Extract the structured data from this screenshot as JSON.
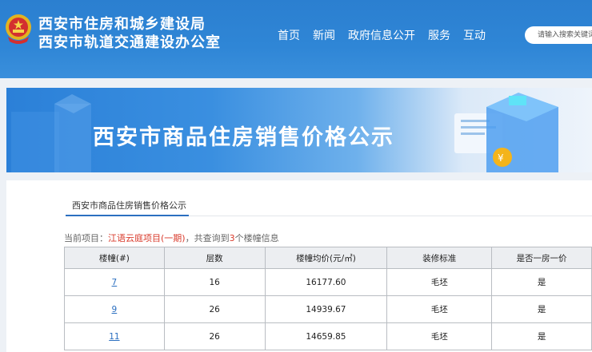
{
  "header": {
    "org_line1": "西安市住房和城乡建设局",
    "org_line2": "西安市轨道交通建设办公室",
    "nav": [
      "首页",
      "新闻",
      "政府信息公开",
      "服务",
      "互动"
    ],
    "search_placeholder": "请输入搜索关键词"
  },
  "banner": {
    "title": "西安市商品住房销售价格公示"
  },
  "tab": {
    "label": "西安市商品住房销售价格公示"
  },
  "summary": {
    "prefix": "当前项目：",
    "project": "江语云庭项目(一期)",
    "middle": "，共查询到",
    "count": "3",
    "suffix": "个楼幢信息"
  },
  "table": {
    "headers": [
      "楼幢(#)",
      "层数",
      "楼幢均价(元/㎡)",
      "装修标准",
      "是否一房一价"
    ],
    "rows": [
      [
        "7",
        "16",
        "16177.60",
        "毛坯",
        "是"
      ],
      [
        "9",
        "26",
        "14939.67",
        "毛坯",
        "是"
      ],
      [
        "11",
        "26",
        "14659.85",
        "毛坯",
        "是"
      ]
    ]
  },
  "colors": {
    "header_blue": "#2f86d6",
    "link_blue": "#2b6fc0",
    "highlight_red": "#d93a2b"
  }
}
